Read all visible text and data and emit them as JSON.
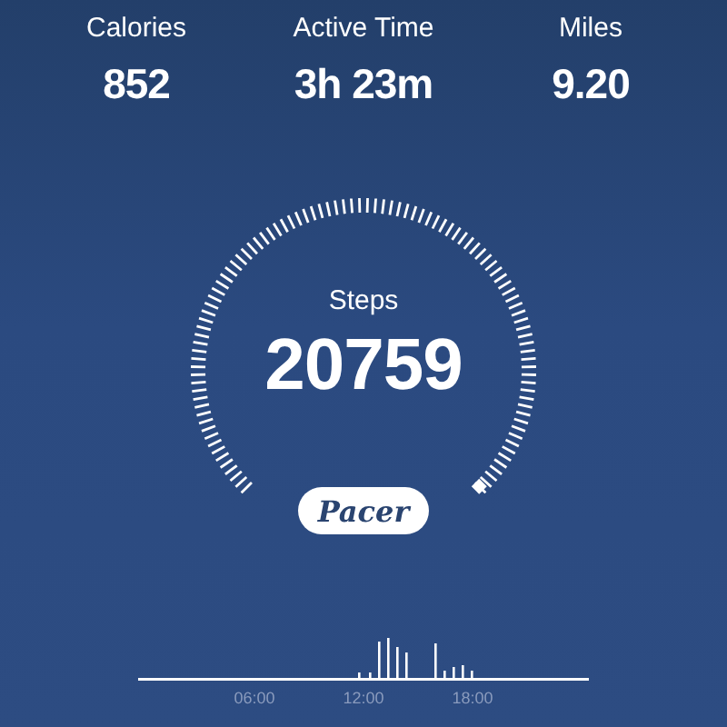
{
  "stats": [
    {
      "label": "Calories",
      "value": "852"
    },
    {
      "label": "Active Time",
      "value": "3h 23m"
    },
    {
      "label": "Miles",
      "value": "9.20"
    }
  ],
  "gauge": {
    "label": "Steps",
    "value": "20759"
  },
  "brand_button": "Pacer",
  "timeline": {
    "labels": [
      "06:00",
      "12:00",
      "18:00"
    ]
  }
}
